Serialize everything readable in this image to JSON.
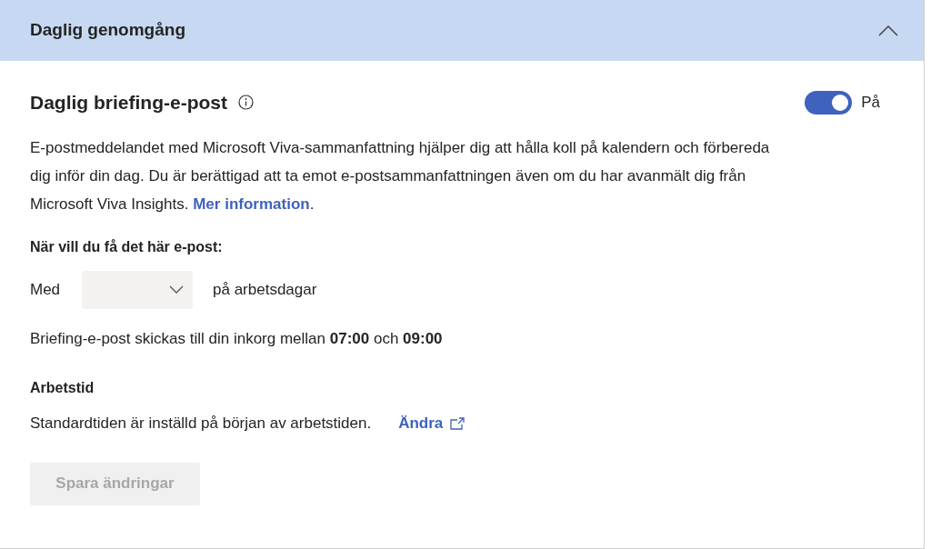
{
  "section": {
    "title": "Daglig genomgång",
    "expanded": true
  },
  "setting": {
    "title": "Daglig briefing-e-post",
    "toggle": {
      "on": true,
      "label": "På"
    },
    "description": {
      "text": "E-postmeddelandet med Microsoft Viva-sammanfattning hjälper dig att hålla koll på kalendern och förbereda dig inför din dag. Du är berättigad att ta emot e-postsammanfattningen även om du har avanmält dig från Microsoft Viva Insights. ",
      "link": "Mer information",
      "after": "."
    }
  },
  "schedule": {
    "question": "När vill du få det här e-post:",
    "prefix": "Med",
    "dropdown": {
      "disabled": false
    },
    "suffix": "på arbetsdagar",
    "note": "Briefing-e-post skickas till din inkorg mellan **07:00** och **09:00**"
  },
  "working_hours": {
    "title": "Arbetstid",
    "text": "Standardtiden är inställd på början av arbetstiden.",
    "link": "Ändra"
  },
  "save_button": {
    "label": "Spara ändringar",
    "disabled": true
  }
}
